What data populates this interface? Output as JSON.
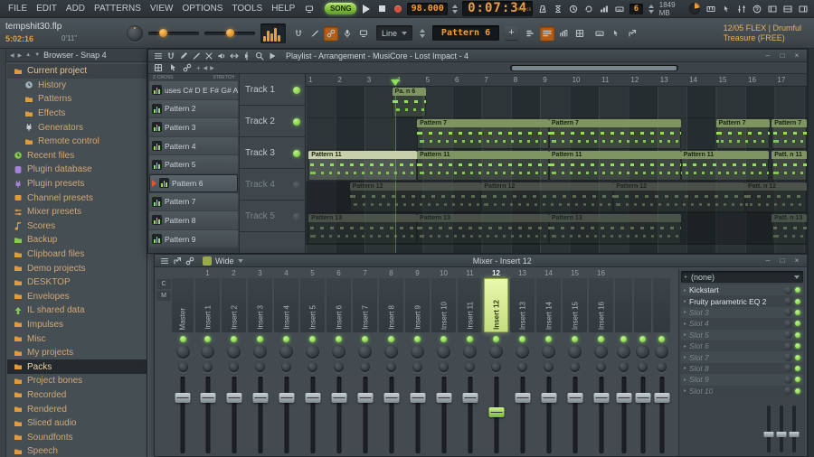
{
  "menubar": {
    "menus": [
      "FILE",
      "EDIT",
      "ADD",
      "PATTERNS",
      "VIEW",
      "OPTIONS",
      "TOOLS",
      "HELP"
    ],
    "transport": {
      "mode": "SONG",
      "tempo": "98.000",
      "time": "0:07:34",
      "time_format": "M:S:CS"
    },
    "transport_icons": [
      "metronome",
      "wait",
      "countdown",
      "loop-record",
      "step-edit",
      "typing-keyboard"
    ],
    "status": {
      "selector_value": "6",
      "memory": "1849 MB"
    },
    "right_icons": [
      "midi-keyboard",
      "touch",
      "sliders",
      "help",
      "workspace-left",
      "workspace-mid",
      "workspace-right"
    ]
  },
  "toolbar": {
    "project_name": "tempshit30.flp",
    "session_time": "5:02:16",
    "song_length": "0'11\"",
    "tool_icons": [
      "magnet",
      "brush",
      "link",
      "mic",
      "monitor"
    ],
    "active_tool_icon": "link",
    "shape_selector": "Line",
    "pattern_selector": "Pattern 6",
    "view_icons": [
      "playlist",
      "piano-roll",
      "event-editor",
      "grid"
    ],
    "active_view_icon": "piano-roll",
    "misc_icons": [
      "typing-keyboard",
      "touch",
      "detach"
    ],
    "hint_line1": "12/05 FLEX | Drumful",
    "hint_line2": "Treasure (FREE)"
  },
  "browser": {
    "title": "Browser - Snap 4",
    "items": [
      {
        "label": "Current project",
        "indent": 0,
        "icon": "folder",
        "color": "#e09a40",
        "state": "open"
      },
      {
        "label": "History",
        "indent": 1,
        "icon": "clock",
        "color": "#9fb4c0"
      },
      {
        "label": "Patterns",
        "indent": 1,
        "icon": "folder",
        "color": "#e09a40"
      },
      {
        "label": "Effects",
        "indent": 1,
        "icon": "folder",
        "color": "#e09a40"
      },
      {
        "label": "Generators",
        "indent": 1,
        "icon": "plug",
        "color": "#c3cbd0"
      },
      {
        "label": "Remote control",
        "indent": 1,
        "icon": "folder",
        "color": "#e09a40"
      },
      {
        "label": "Recent files",
        "indent": 0,
        "icon": "clock",
        "color": "#86c94e"
      },
      {
        "label": "Plugin database",
        "indent": 0,
        "icon": "database",
        "color": "#a583d6"
      },
      {
        "label": "Plugin presets",
        "indent": 0,
        "icon": "plug",
        "color": "#a583d6"
      },
      {
        "label": "Channel presets",
        "indent": 0,
        "icon": "box",
        "color": "#e09a40"
      },
      {
        "label": "Mixer presets",
        "indent": 0,
        "icon": "slider",
        "color": "#e09a40"
      },
      {
        "label": "Scores",
        "indent": 0,
        "icon": "note",
        "color": "#e09a40"
      },
      {
        "label": "Backup",
        "indent": 0,
        "icon": "folder",
        "color": "#86c94e"
      },
      {
        "label": "Clipboard files",
        "indent": 0,
        "icon": "folder",
        "color": "#e09a40"
      },
      {
        "label": "Demo projects",
        "indent": 0,
        "icon": "folder",
        "color": "#e09a40"
      },
      {
        "label": "DESKTOP",
        "indent": 0,
        "icon": "folder",
        "color": "#e09a40"
      },
      {
        "label": "Envelopes",
        "indent": 0,
        "icon": "folder",
        "color": "#e09a40"
      },
      {
        "label": "IL shared data",
        "indent": 0,
        "icon": "arrow-up",
        "color": "#86c94e"
      },
      {
        "label": "Impulses",
        "indent": 0,
        "icon": "folder",
        "color": "#e09a40"
      },
      {
        "label": "Misc",
        "indent": 0,
        "icon": "folder",
        "color": "#e09a40"
      },
      {
        "label": "My projects",
        "indent": 0,
        "icon": "folder",
        "color": "#e09a40"
      },
      {
        "label": "Packs",
        "indent": 0,
        "icon": "folder",
        "color": "#e09a40",
        "selected": true
      },
      {
        "label": "Project bones",
        "indent": 0,
        "icon": "folder",
        "color": "#e09a40"
      },
      {
        "label": "Recorded",
        "indent": 0,
        "icon": "folder",
        "color": "#e09a40"
      },
      {
        "label": "Rendered",
        "indent": 0,
        "icon": "folder",
        "color": "#e09a40"
      },
      {
        "label": "Sliced audio",
        "indent": 0,
        "icon": "folder",
        "color": "#e09a40"
      },
      {
        "label": "Soundfonts",
        "indent": 0,
        "icon": "folder",
        "color": "#e09a40"
      },
      {
        "label": "Speech",
        "indent": 0,
        "icon": "folder",
        "color": "#e09a40"
      }
    ]
  },
  "playlist": {
    "title": "Playlist - Arrangement - MusiCore - Lost Impact - 4",
    "titlebar_icons": [
      "menu",
      "magnet",
      "pencil",
      "brush",
      "delete",
      "mute",
      "slip",
      "slice",
      "zoom",
      "preview"
    ],
    "toolbar2_icons": [
      "grid",
      "pointer",
      "link"
    ],
    "picker_header": {
      "left": "Z-CROSS",
      "right": "STRETCH"
    },
    "patterns": [
      {
        "label": "uses C# D E F# G# A B"
      },
      {
        "label": "Pattern 2"
      },
      {
        "label": "Pattern 3"
      },
      {
        "label": "Pattern 4"
      },
      {
        "label": "Pattern 5"
      },
      {
        "label": "Pattern 6",
        "selected": true
      },
      {
        "label": "Pattern 7"
      },
      {
        "label": "Pattern 8"
      },
      {
        "label": "Pattern 9"
      }
    ],
    "tracks": [
      {
        "name": "Track 1",
        "muted": false
      },
      {
        "name": "Track 2",
        "muted": false
      },
      {
        "name": "Track 3",
        "muted": false
      },
      {
        "name": "Track 4",
        "muted": true
      },
      {
        "name": "Track 5",
        "muted": true
      }
    ],
    "ruler": {
      "start": 1,
      "end": 18
    },
    "playhead_bar": 4.07,
    "clips": [
      {
        "track": 0,
        "start_bar": 3.95,
        "length_bars": 1.15,
        "label": "Pa. n 6"
      },
      {
        "track": 1,
        "start_bar": 4.8,
        "length_bars": 4.5,
        "label": "Pattern 7"
      },
      {
        "track": 1,
        "start_bar": 9.3,
        "length_bars": 4.5,
        "label": "Pattern 7"
      },
      {
        "track": 1,
        "start_bar": 15.0,
        "length_bars": 1.85,
        "label": "Pattern 7"
      },
      {
        "track": 1,
        "start_bar": 16.9,
        "length_bars": 1.2,
        "label": "Pattern 7"
      },
      {
        "track": 2,
        "start_bar": 1.1,
        "length_bars": 3.7,
        "label": "Pattern 11",
        "selected": true
      },
      {
        "track": 2,
        "start_bar": 4.8,
        "length_bars": 4.5,
        "label": "Pattern 11"
      },
      {
        "track": 2,
        "start_bar": 9.3,
        "length_bars": 4.5,
        "label": "Pattern 11"
      },
      {
        "track": 2,
        "start_bar": 13.8,
        "length_bars": 3.0,
        "label": "Pattern 11"
      },
      {
        "track": 2,
        "start_bar": 16.9,
        "length_bars": 1.2,
        "label": "Patt. n 11"
      },
      {
        "track": 3,
        "start_bar": 2.5,
        "length_bars": 4.5,
        "label": "Pattern 12"
      },
      {
        "track": 3,
        "start_bar": 7.0,
        "length_bars": 4.5,
        "label": "Pattern 12"
      },
      {
        "track": 3,
        "start_bar": 11.5,
        "length_bars": 4.5,
        "label": "Pattern 12"
      },
      {
        "track": 3,
        "start_bar": 16.0,
        "length_bars": 2.1,
        "label": "Patt. n 12"
      },
      {
        "track": 4,
        "start_bar": 1.1,
        "length_bars": 3.7,
        "label": "Pattern 13"
      },
      {
        "track": 4,
        "start_bar": 4.8,
        "length_bars": 4.5,
        "label": "Pattern 13"
      },
      {
        "track": 4,
        "start_bar": 9.3,
        "length_bars": 4.5,
        "label": "Pattern 13"
      },
      {
        "track": 4,
        "start_bar": 16.9,
        "length_bars": 1.2,
        "label": "Patt. n 13"
      }
    ]
  },
  "mixer": {
    "title": "Mixer - Insert 12",
    "view_mode": "Wide",
    "toolbar_icons": [
      "menu",
      "detach",
      "link"
    ],
    "special_labels": [
      "C",
      "M"
    ],
    "selected_channel": "Insert 12",
    "channels": [
      {
        "name": "Master",
        "number": ""
      },
      {
        "name": "Insert 1",
        "number": "1"
      },
      {
        "name": "Insert 2",
        "number": "2"
      },
      {
        "name": "Insert 3",
        "number": "3"
      },
      {
        "name": "Insert 4",
        "number": "4"
      },
      {
        "name": "Insert 5",
        "number": "5"
      },
      {
        "name": "Insert 6",
        "number": "6"
      },
      {
        "name": "Insert 7",
        "number": "7"
      },
      {
        "name": "Insert 8",
        "number": "8"
      },
      {
        "name": "Insert 9",
        "number": "9"
      },
      {
        "name": "Insert 10",
        "number": "10"
      },
      {
        "name": "Insert 11",
        "number": "11"
      },
      {
        "name": "Insert 12",
        "number": "12",
        "selected": true
      },
      {
        "name": "Insert 13",
        "number": "13"
      },
      {
        "name": "Insert 14",
        "number": "14"
      },
      {
        "name": "Insert 15",
        "number": "15"
      },
      {
        "name": "Insert 16",
        "number": "16"
      }
    ],
    "extra_strip_count": 3,
    "rack": {
      "preset_selector": "(none)",
      "slots": [
        {
          "label": "Kickstart",
          "active": true
        },
        {
          "label": "Fruity parametric EQ 2",
          "active": true
        },
        {
          "label": "Slot 3",
          "active": false
        },
        {
          "label": "Slot 4",
          "active": false
        },
        {
          "label": "Slot 5",
          "active": false
        },
        {
          "label": "Slot 6",
          "active": false
        },
        {
          "label": "Slot 7",
          "active": false
        },
        {
          "label": "Slot 8",
          "active": false
        },
        {
          "label": "Slot 9",
          "active": false
        },
        {
          "label": "Slot 10",
          "active": false
        }
      ]
    }
  }
}
